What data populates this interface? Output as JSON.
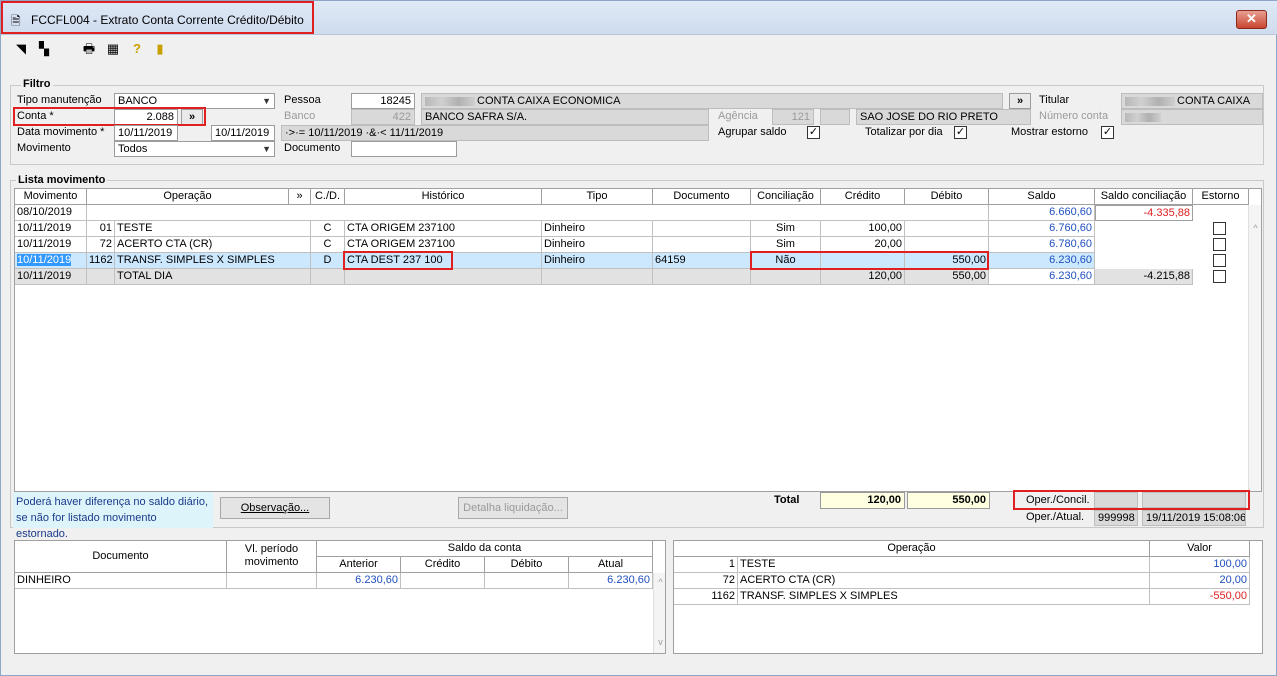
{
  "window": {
    "title": "FCCFL004 - Extrato Conta Corrente Crédito/Débito",
    "close_label": "✕"
  },
  "filtro": {
    "group_label": "Filtro",
    "tipo_manutencao_label": "Tipo manutenção",
    "tipo_manutencao_value": "BANCO",
    "conta_label": "Conta *",
    "conta_value": "2.088",
    "data_movimento_label": "Data movimento *",
    "data_de": "10/11/2019",
    "data_ate": "10/11/2019",
    "data_expr": "·>·= 10/11/2019 ·&·< 11/11/2019",
    "movimento_label": "Movimento",
    "movimento_value": "Todos",
    "pessoa_label": "Pessoa",
    "pessoa_value": "18245",
    "pessoa_nome": "CONTA CAIXA ECONOMICA",
    "banco_label": "Banco",
    "banco_value": "422",
    "banco_nome": "BANCO SAFRA S/A.",
    "agencia_label": "Agência",
    "agencia_value": "121",
    "agencia_cidade": "SAO JOSE DO RIO PRETO",
    "documento_label": "Documento",
    "documento_value": "",
    "titular_label": "Titular",
    "titular_value": "CONTA CAIXA",
    "numero_conta_label": "Número conta",
    "agrupar_saldo_label": "Agrupar saldo",
    "totalizar_dia_label": "Totalizar por dia",
    "mostrar_estorno_label": "Mostrar estorno",
    "expand_label": "»"
  },
  "lista": {
    "group_label": "Lista movimento",
    "headers": [
      "Movimento",
      "Operação",
      "»",
      "C./D.",
      "Histórico",
      "Tipo",
      "Documento",
      "Conciliação",
      "Crédito",
      "Débito",
      "Saldo",
      "Saldo conciliação",
      "Estorno"
    ],
    "rows": [
      {
        "mov": "08/10/2019",
        "op_num": "",
        "op": "",
        "cd": "",
        "hist": "",
        "tipo": "",
        "doc": "",
        "conc": "",
        "cred": "",
        "deb": "",
        "saldo": "6.660,60",
        "saldo_conc": "-4.335,88"
      },
      {
        "mov": "10/11/2019",
        "op_num": "01",
        "op": "TESTE",
        "cd": "C",
        "hist": "CTA ORIGEM  237100",
        "tipo": "Dinheiro",
        "doc": "",
        "conc": "Sim",
        "cred": "100,00",
        "deb": "",
        "saldo": "6.760,60",
        "saldo_conc": ""
      },
      {
        "mov": "10/11/2019",
        "op_num": "72",
        "op": "ACERTO CTA (CR)",
        "cd": "C",
        "hist": "CTA ORIGEM  237100",
        "tipo": "Dinheiro",
        "doc": "",
        "conc": "Sim",
        "cred": "20,00",
        "deb": "",
        "saldo": "6.780,60",
        "saldo_conc": ""
      },
      {
        "mov": "10/11/2019",
        "op_num": "1162",
        "op": "TRANSF. SIMPLES X SIMPLES",
        "cd": "D",
        "hist": "CTA DEST  237 100",
        "tipo": "Dinheiro",
        "doc": "64159",
        "conc": "Não",
        "cred": "",
        "deb": "550,00",
        "saldo": "6.230,60",
        "saldo_conc": ""
      },
      {
        "mov": "10/11/2019",
        "op_num": "",
        "op": "TOTAL DIA",
        "cd": "",
        "hist": "",
        "tipo": "",
        "doc": "",
        "conc": "",
        "cred": "120,00",
        "deb": "550,00",
        "saldo": "6.230,60",
        "saldo_conc": "-4.215,88"
      }
    ]
  },
  "footer": {
    "note_line1": "Poderá haver diferença no saldo diário,",
    "note_line2": "se não for listado movimento estornado.",
    "observacao_button": "Observação...",
    "detalha_button": "Detalha liquidação...",
    "total_label": "Total",
    "total_credito": "120,00",
    "total_debito": "550,00",
    "oper_concil_label": "Oper./Concil.",
    "oper_atual_label": "Oper./Atual.",
    "oper_atual_user": "999998",
    "oper_atual_datetime": "19/11/2019 15:08:06"
  },
  "saldo_grid": {
    "headers": {
      "documento": "Documento",
      "vl_periodo": "Vl. período movimento",
      "saldo_conta": "Saldo da conta",
      "anterior": "Anterior",
      "credito": "Crédito",
      "debito": "Débito",
      "atual": "Atual"
    },
    "rows": [
      {
        "documento": "DINHEIRO",
        "vl_periodo": "",
        "anterior": "6.230,60",
        "credito": "",
        "debito": "",
        "atual": "6.230,60"
      }
    ]
  },
  "operacao_grid": {
    "headers": {
      "operacao": "Operação",
      "valor": "Valor"
    },
    "rows": [
      {
        "num": "1",
        "nome": "TESTE",
        "valor": "100,00"
      },
      {
        "num": "72",
        "nome": "ACERTO CTA (CR)",
        "valor": "20,00"
      },
      {
        "num": "1162",
        "nome": "TRANSF. SIMPLES X SIMPLES",
        "valor": "-550,00"
      }
    ]
  },
  "colors": {
    "accent_red": "#e02020",
    "selection": "#cce8ff",
    "value_blue": "#1f4fbf"
  }
}
